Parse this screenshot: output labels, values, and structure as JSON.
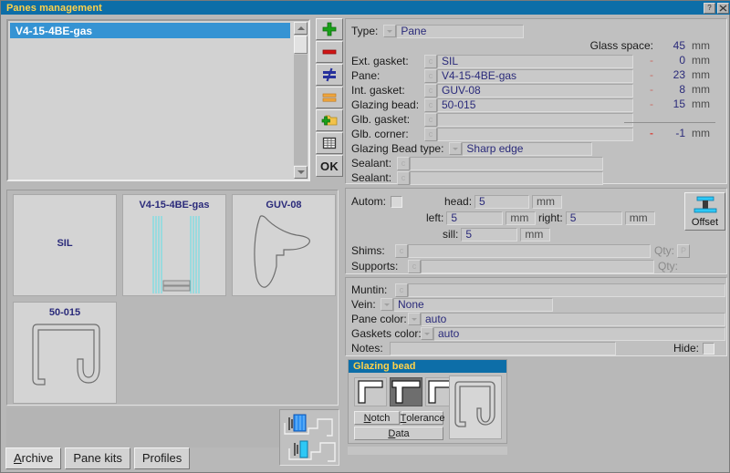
{
  "window": {
    "title": "Panes management",
    "help_button": "?",
    "close_button": "x"
  },
  "list": {
    "items": [
      {
        "label": "V4-15-4BE-gas",
        "selected": true
      }
    ],
    "scroll_up": "scroll-up",
    "scroll_down": "scroll-down"
  },
  "toolbar": {
    "buttons": [
      {
        "name": "add-button",
        "icon": "plus-icon",
        "label": ""
      },
      {
        "name": "remove-button",
        "icon": "minus-icon",
        "label": ""
      },
      {
        "name": "swap-button",
        "icon": "not-equal-icon",
        "label": ""
      },
      {
        "name": "list-button",
        "icon": "bars-icon",
        "label": ""
      },
      {
        "name": "new-folder-button",
        "icon": "folder-plus-icon",
        "label": ""
      },
      {
        "name": "table-button",
        "icon": "grid-icon",
        "label": ""
      },
      {
        "name": "ok-button",
        "icon": "ok-icon",
        "label": "OK"
      }
    ]
  },
  "previews": {
    "cards": [
      {
        "title": "",
        "center_label": "SIL",
        "drawing": "none"
      },
      {
        "title": "V4-15-4BE-gas",
        "center_label": "",
        "drawing": "glass-unit"
      },
      {
        "title": "GUV-08",
        "center_label": "",
        "drawing": "gasket-profile"
      },
      {
        "title": "50-015",
        "center_label": "",
        "drawing": "bead-profile"
      }
    ]
  },
  "tabs": [
    {
      "label": "Archive",
      "mnemonic": "A",
      "active": true
    },
    {
      "label": "Pane kits",
      "mnemonic": "",
      "active": false
    },
    {
      "label": "Profiles",
      "mnemonic": "",
      "active": false
    }
  ],
  "details": {
    "type_label": "Type:",
    "type_value": "Pane",
    "glass_space_label": "Glass space:",
    "glass_space_value": "45",
    "glass_space_unit": "mm",
    "rows": [
      {
        "label": "Ext. gasket:",
        "value": "SIL",
        "dash": "-",
        "num": "0",
        "unit": "mm"
      },
      {
        "label": "Pane:",
        "value": "V4-15-4BE-gas",
        "dash": "-",
        "num": "23",
        "unit": "mm"
      },
      {
        "label": "Int. gasket:",
        "value": "GUV-08",
        "dash": "-",
        "num": "8",
        "unit": "mm"
      },
      {
        "label": "Glazing bead:",
        "value": "50-015",
        "dash": "-",
        "num": "15",
        "unit": "mm"
      },
      {
        "label": "Glb. gasket:",
        "value": "",
        "dash": "",
        "num": "",
        "unit": ""
      },
      {
        "label": "Glb. corner:",
        "value": "",
        "dash": "-",
        "num": "-1",
        "unit": "mm"
      }
    ],
    "bead_type_label": "Glazing Bead type:",
    "bead_type_value": "Sharp edge",
    "sealant1_label": "Sealant:",
    "sealant1_value": "",
    "sealant2_label": "Sealant:",
    "sealant2_value": ""
  },
  "autom": {
    "label": "Autom:",
    "checkbox_checked": false,
    "head_label": "head:",
    "head_value": "5",
    "head_unit": "mm",
    "left_label": "left:",
    "left_value": "5",
    "left_unit": "mm",
    "right_label": "right:",
    "right_value": "5",
    "right_unit": "mm",
    "sill_label": "sill:",
    "sill_value": "5",
    "sill_unit": "mm",
    "offset_label": "Offset",
    "shims_label": "Shims:",
    "shims_value": "",
    "shims_qty_label": "Qty:",
    "shims_qty_value": "P",
    "supports_label": "Supports:",
    "supports_value": "",
    "supports_qty_label": "Qty:",
    "supports_qty_value": ""
  },
  "options": {
    "muntin_label": "Muntin:",
    "muntin_value": "",
    "vein_label": "Vein:",
    "vein_value": "None",
    "pane_color_label": "Pane color:",
    "pane_color_value": "auto",
    "gaskets_color_label": "Gaskets color:",
    "gaskets_color_value": "auto",
    "notes_label": "Notes:",
    "notes_value": "",
    "hide_label": "Hide:",
    "hide_checked": false
  },
  "glazing_bead": {
    "header": "Glazing bead",
    "shapes": [
      {
        "name": "bead-shape-1",
        "selected": false
      },
      {
        "name": "bead-shape-2",
        "selected": true
      },
      {
        "name": "bead-shape-3",
        "selected": false
      }
    ],
    "notch_label": "Notch",
    "notch_mnemonic": "N",
    "tolerance_label": "Tolerance",
    "tolerance_mnemonic": "T",
    "data_label": "Data",
    "data_mnemonic": "D"
  },
  "colors": {
    "title_bar": "#0d6ea8",
    "title_text": "#ffd24a",
    "selection": "#3593d3",
    "value_text": "#2a2a7a",
    "dash_red": "#c86a64",
    "glass_cyan": "#5fe0e8",
    "window_bg": "#b8b8b8"
  }
}
